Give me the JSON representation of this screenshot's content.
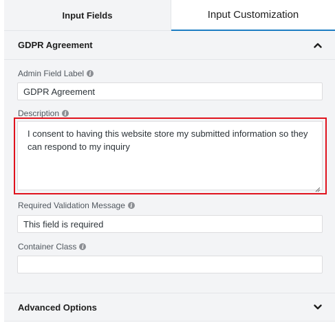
{
  "tabs": [
    {
      "label": "Input Fields"
    },
    {
      "label": "Input Customization"
    }
  ],
  "gdpr_section": {
    "title": "GDPR Agreement",
    "chevron_icon": "chevron-up-icon"
  },
  "fields": {
    "admin_label": {
      "label": "Admin Field Label",
      "value": "GDPR Agreement"
    },
    "description": {
      "label": "Description",
      "value": "I consent to having this website store my submitted information so they can respond to my inquiry"
    },
    "required_message": {
      "label": "Required Validation Message",
      "value": "This field is required"
    },
    "container_class": {
      "label": "Container Class",
      "value": ""
    }
  },
  "help_glyph": "i",
  "advanced_section": {
    "title": "Advanced Options",
    "chevron_icon": "chevron-down-icon"
  },
  "colors": {
    "active_tab_underline": "#1a7cc2",
    "highlight_border": "#e0111c"
  }
}
